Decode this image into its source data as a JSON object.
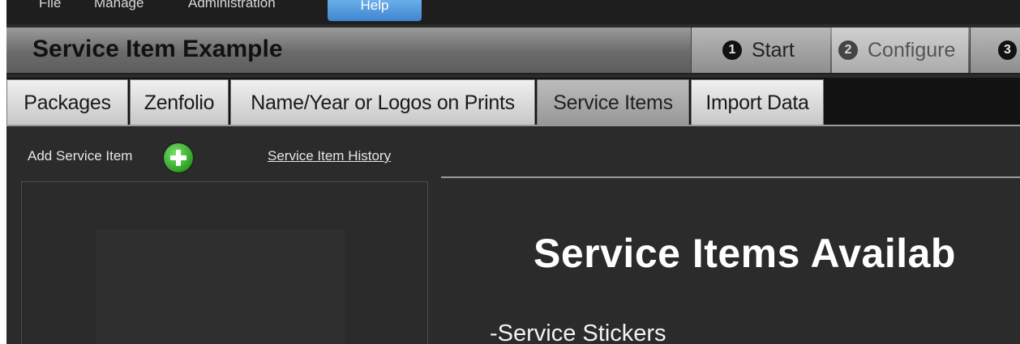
{
  "menubar": {
    "items": [
      {
        "label": "File"
      },
      {
        "label": "Manage"
      },
      {
        "label": "Administration"
      },
      {
        "label": "Help"
      }
    ]
  },
  "header": {
    "title": "Service Item Example",
    "steps": [
      {
        "num": "1",
        "label": "Start"
      },
      {
        "num": "2",
        "label": "Configure"
      },
      {
        "num": "3",
        "label": ""
      }
    ]
  },
  "tabs": [
    {
      "label": "Packages"
    },
    {
      "label": "Zenfolio"
    },
    {
      "label": "Name/Year or Logos on Prints"
    },
    {
      "label": "Service Items",
      "active": true
    },
    {
      "label": "Import Data"
    }
  ],
  "left_panel": {
    "add_label": "Add Service Item",
    "add_icon": "plus-circle-icon",
    "history_link": "Service Item History"
  },
  "content": {
    "heading": "Service Items Availab",
    "items": [
      "-Service Stickers"
    ]
  },
  "colors": {
    "background": "#2b2b2b",
    "help_accent": "#4a90d9",
    "add_button": "#3cb02e",
    "active_tab": "#a8a8a8"
  }
}
